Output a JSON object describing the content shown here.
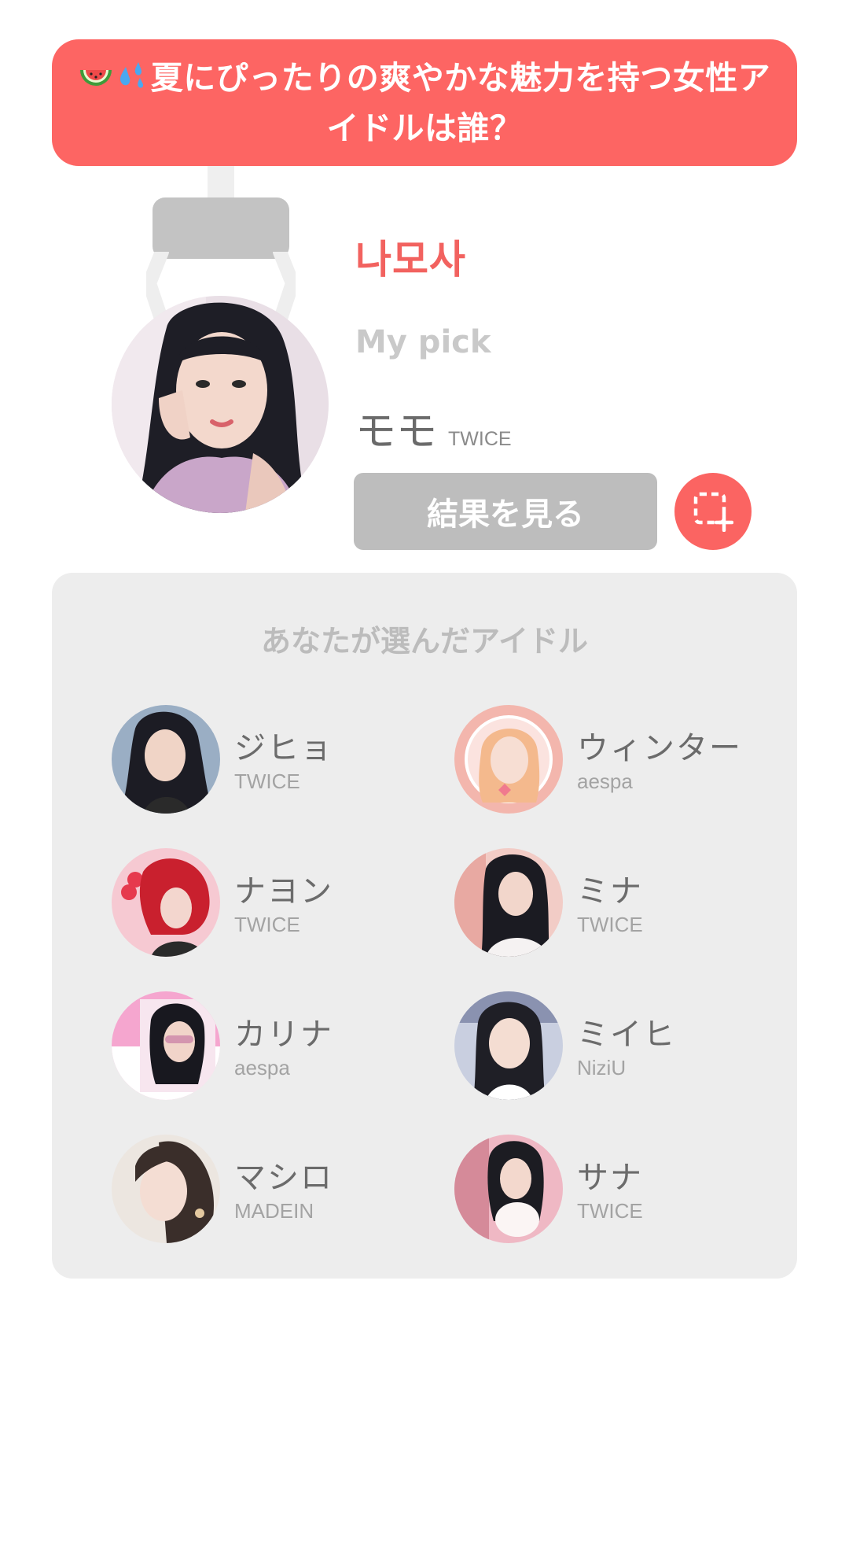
{
  "banner": {
    "emoji_1": "watermelon-icon",
    "emoji_2": "sweat-drops-icon",
    "title": "夏にぴったりの爽やかな魅力を持つ女性アイドルは誰？"
  },
  "brand": {
    "name": "나모사"
  },
  "pick": {
    "label": "My pick",
    "name": "モモ",
    "group": "TWICE"
  },
  "actions": {
    "result_label": "結果を見る",
    "capture_icon": "screenshot-capture-icon"
  },
  "selected": {
    "title": "あなたが選んだアイドル",
    "idols": [
      {
        "name": "ジヒョ",
        "group": "TWICE"
      },
      {
        "name": "ウィンター",
        "group": "aespa"
      },
      {
        "name": "ナヨン",
        "group": "TWICE"
      },
      {
        "name": "ミナ",
        "group": "TWICE"
      },
      {
        "name": "カリナ",
        "group": "aespa"
      },
      {
        "name": "ミイヒ",
        "group": "NiziU"
      },
      {
        "name": "マシロ",
        "group": "MADEIN"
      },
      {
        "name": "サナ",
        "group": "TWICE"
      }
    ]
  },
  "colors": {
    "accent": "#fd6563",
    "button_gray": "#bdbdbd",
    "panel_bg": "#ededed"
  }
}
